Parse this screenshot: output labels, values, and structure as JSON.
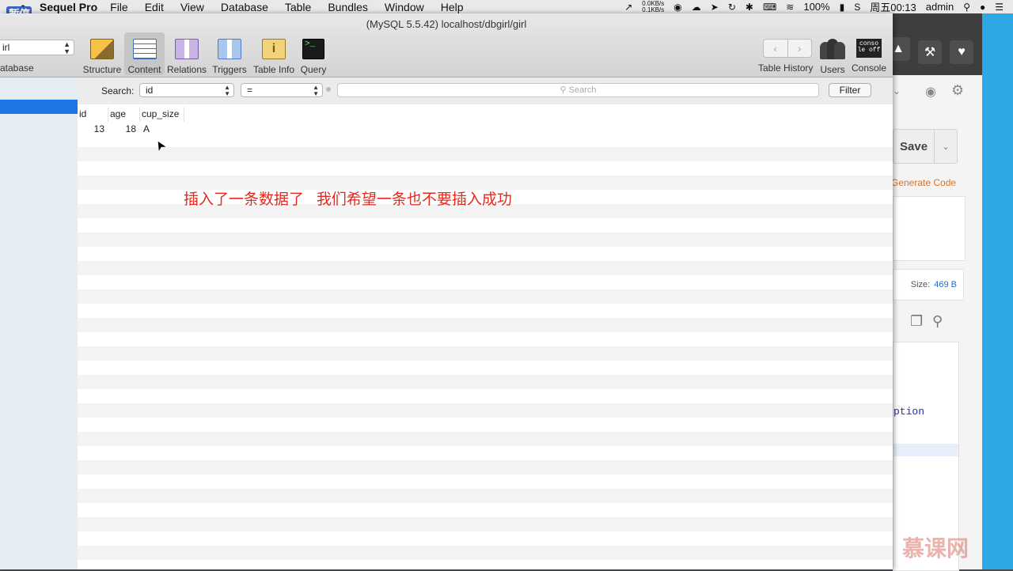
{
  "menubar": {
    "app_name": "Sequel Pro",
    "items": [
      "File",
      "Edit",
      "View",
      "Database",
      "Table",
      "Bundles",
      "Window",
      "Help"
    ],
    "net_up": "0.0KB/s",
    "net_down": "0.1KB/s",
    "battery": "100%",
    "clock": "周五00:13",
    "user": "admin"
  },
  "paused_badge": "暂停",
  "window": {
    "title": "(MySQL 5.5.42) localhost/dbgirl/girl",
    "database_select": "irl",
    "database_label": "atabase"
  },
  "toolbar": {
    "structure": "Structure",
    "content": "Content",
    "relations": "Relations",
    "triggers": "Triggers",
    "table_info": "Table Info",
    "query": "Query",
    "table_history": "Table History",
    "users": "Users",
    "console": "Console",
    "console_icon_text": "conso le off",
    "info_icon_text": "i"
  },
  "filter": {
    "search_label": "Search:",
    "field": "id",
    "operator": "=",
    "search_placeholder": "Search",
    "filter_button": "Filter"
  },
  "grid": {
    "columns": [
      "id",
      "age",
      "cup_size"
    ],
    "rows": [
      [
        "13",
        "18",
        "A"
      ]
    ]
  },
  "annotation": "插入了一条数据了   我们希望一条也不要插入成功",
  "background_app": {
    "save": "Save",
    "generate_code": "Generate Code",
    "size_label": "Size:",
    "size_value": "469 B",
    "code_fragment": "ption"
  },
  "watermark": "慕课网"
}
